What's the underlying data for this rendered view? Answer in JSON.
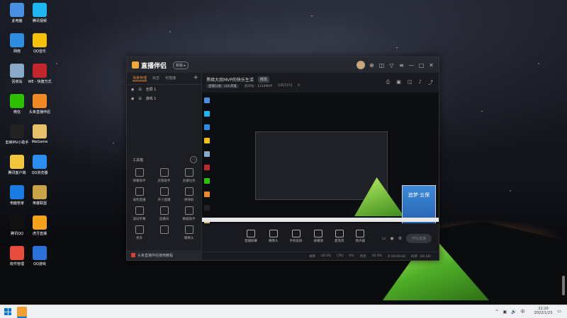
{
  "desktop": {
    "icons": [
      {
        "label": "此电脑",
        "color": "#4a90e2",
        "icon": "computer-icon"
      },
      {
        "label": "腾讯视频",
        "color": "#1fb5f0",
        "icon": "video-icon"
      },
      {
        "label": "网络",
        "color": "#2f8ee0",
        "icon": "network-icon"
      },
      {
        "label": "QQ音乐",
        "color": "#f6c10d",
        "icon": "music-icon"
      },
      {
        "label": "回收站",
        "color": "#8aa9c9",
        "icon": "recycle-bin-icon"
      },
      {
        "label": "WE - 快捷方式",
        "color": "#c0262b",
        "icon": "we-icon"
      },
      {
        "label": "微信",
        "color": "#2dc100",
        "icon": "wechat-icon"
      },
      {
        "label": "头条直播伴侣",
        "color": "#f08a24",
        "icon": "toutiao-icon"
      },
      {
        "label": "剪映MV小助手",
        "color": "#222222",
        "icon": "editor-icon"
      },
      {
        "label": "WeGame",
        "color": "#e8c069",
        "icon": "wegame-icon"
      },
      {
        "label": "腾讯客户端",
        "color": "#f3c53b",
        "icon": "folder-icon"
      },
      {
        "label": "QQ浏览器",
        "color": "#2a8ff0",
        "icon": "browser-icon"
      },
      {
        "label": "电脑管家",
        "color": "#1a7be0",
        "icon": "shield-icon"
      },
      {
        "label": "英雄联盟",
        "color": "#c8a34a",
        "icon": "lol-icon"
      },
      {
        "label": "腾讯QQ",
        "color": "#111111",
        "icon": "qq-icon"
      },
      {
        "label": "虎牙直播",
        "color": "#f7a21b",
        "icon": "huya-icon"
      },
      {
        "label": "软件管理",
        "color": "#e84c3d",
        "icon": "software-icon"
      },
      {
        "label": "QQ游戏",
        "color": "#2b6fd8",
        "icon": "qqgame-icon"
      }
    ]
  },
  "app": {
    "title": "直播伴侣",
    "version": "新版 ▸",
    "titlebar_icons": [
      "avatar",
      "⊕",
      "◫",
      "▽",
      "≡",
      "—",
      "□",
      "✕"
    ],
    "tabs": [
      {
        "label": "场景管理",
        "active": true
      },
      {
        "label": "双击",
        "active": false
      },
      {
        "label": "可拖拽",
        "active": false
      }
    ],
    "add_tab": "+",
    "scenes": [
      {
        "label": "全屏 1"
      },
      {
        "label": "游戏 1"
      }
    ],
    "tools_header": "工具箱",
    "tools": [
      "弹幕助手",
      "房管助手",
      "主播任务",
      "福利直播",
      "开小直播",
      "弹弹屏",
      "滚动字幕",
      "直播间",
      "数据助手",
      "更多",
      "",
      "摄像头"
    ],
    "notice": "头条直播伴侣使用教程",
    "live_title": "黑暗大叔MVP的快乐生活",
    "edit_label": "修改",
    "meta": {
      "category": "直播分类：LOL英雄",
      "room": "房间号：1234MVP",
      "id": "5357373",
      "fans": "0"
    },
    "main_icons": [
      "⎙",
      "▣",
      "◫",
      "♪",
      "⤴"
    ],
    "preview_phone_text": "追梦·五保",
    "controls": [
      {
        "label": "直播屏幕",
        "icon": "screen-icon"
      },
      {
        "label": "摄像头",
        "icon": "camera-icon"
      },
      {
        "label": "手机投屏",
        "icon": "phone-cast-icon"
      },
      {
        "label": "录播放",
        "icon": "play-icon"
      },
      {
        "label": "麦克风",
        "icon": "mic-icon"
      },
      {
        "label": "扬声器",
        "icon": "speaker-icon"
      }
    ],
    "right_controls": [
      "▭",
      "◉",
      "⚙"
    ],
    "start_button": "开始直播",
    "status": [
      "帧率",
      "00.0%",
      "CPU",
      "0%",
      "内存",
      "00.0%",
      "⏱ 00:00:02",
      "码率（00.00）"
    ]
  },
  "taskbar": {
    "tray_icons": [
      "^",
      "▣",
      "🔊",
      "中"
    ],
    "time": "22:20",
    "date": "2022/1/23"
  }
}
